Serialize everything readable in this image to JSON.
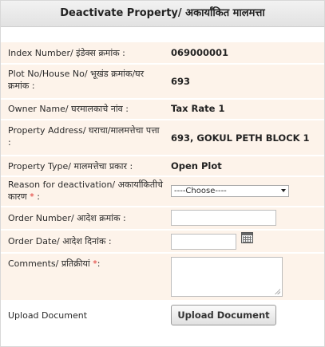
{
  "header": {
    "title": "Deactivate Property/ अकार्यांकित मालमत्ता"
  },
  "fields": {
    "index_number": {
      "label": "Index Number/ इंडेक्स क्रमांक :",
      "value": "069000001"
    },
    "plot_no": {
      "label": "Plot No/House No/ भूखंड क्रमांक/घर क्रमांक :",
      "value": "693"
    },
    "owner_name": {
      "label": "Owner Name/ घरमालकाचे नांव :",
      "value": "Tax Rate 1"
    },
    "property_address": {
      "label": "Property Address/ घराचा/मालमत्तेचा पत्ता :",
      "value": "693, GOKUL PETH BLOCK 1"
    },
    "property_type": {
      "label": "Property Type/ मालमत्तेचा प्रकार :",
      "value": "Open Plot"
    },
    "reason": {
      "label": "Reason for deactivation/ अकार्यांकितीचे कारण",
      "required_mark": "*",
      "suffix": ":",
      "selected": "----Choose----"
    },
    "order_number": {
      "label": "Order Number/ आदेश क्रमांक :",
      "value": ""
    },
    "order_date": {
      "label": "Order Date/ आदेश दिनांक :",
      "value": ""
    },
    "comments": {
      "label": "Comments/ प्रतिक्रीयां",
      "required_mark": "*",
      "suffix": ":",
      "value": ""
    },
    "upload": {
      "label": "Upload Document",
      "button_label": "Upload Document"
    }
  },
  "colors": {
    "alt_row": "#fdf3ea",
    "required": "#e0302b"
  },
  "icons": {
    "calendar": "calendar-icon",
    "dropdown": "chevron-down-icon",
    "resize": "resize-grip-icon"
  }
}
